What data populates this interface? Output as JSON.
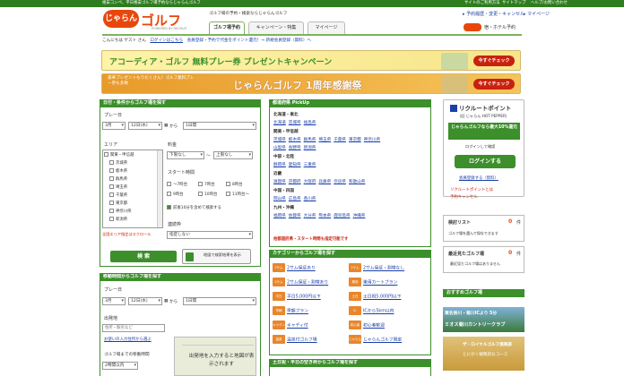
{
  "topbar": {
    "left_text": "格安コンペ、平日格安ゴルフ場予約ならじゃらんゴルフ",
    "right_links": [
      "サイトのご利用方法",
      "サイトマップ",
      "ヘルプ/お問い合わせ"
    ]
  },
  "header": {
    "brand_badge": "じゃらん",
    "brand_golf": "ゴルフ",
    "brand_sub": "POWERED BY RECRUIT",
    "tagline": "ゴルフ場の予約・検索ならじゃらんゴルフ",
    "top_links": [
      "予約履歴・変更・キャンセル",
      "マイページ"
    ],
    "tabs": [
      "ゴルフ場予約",
      "キャンペーン・特集",
      "マイページ"
    ],
    "hotel_link": "宿・ホテル予約",
    "welcome": "こんにちは ゲスト さん",
    "login": "ログインはこちら",
    "info": "会員登録・予約で代金をポイント還元！→ 新規会員登録（無料）へ"
  },
  "banners": [
    {
      "text": "アコーディア・ゴルフ 無料プレー券 プレゼントキャンペーン",
      "button": "今すぐチェック",
      "color": "#f6e58a"
    },
    {
      "text": "じゃらんゴルフ 1周年感謝祭",
      "sub": "豪華プレゼントもりだくさん！ゴルフ無料プレー券も多数",
      "button": "今すぐチェック",
      "color": "#f3b43a"
    }
  ],
  "left_panel": {
    "title": "日付・条件からゴルフ場を探す",
    "play_date_label": "プレー日",
    "month": "3月",
    "day": "12日(水)",
    "from": "から",
    "range": "1日間",
    "area_label": "エリア",
    "areas": [
      "関東・甲信越",
      "茨城県",
      "栃木県",
      "群馬県",
      "埼玉県",
      "千葉県",
      "東京都",
      "神奈川県",
      "新潟県"
    ],
    "area_note": "全国エリア指定はスクロール",
    "price_label": "料金",
    "price_min": "下限なし",
    "price_tilde": "〜",
    "price_max": "上限なし",
    "start_label": "スタート時間",
    "starts": [
      "〜7時台",
      "7時台",
      "8時台",
      "9時台",
      "10時台",
      "11時台〜"
    ],
    "start_note": "前後10分を含めて検索する",
    "route_label": "連続枠",
    "route_value": "指定しない",
    "search_button": "検 索",
    "map_button": "地図で検索結果を表示"
  },
  "left_panel2": {
    "title": "移動時間からゴルフ場を探す",
    "play_date_label": "プレー日",
    "month": "3月",
    "day": "12日(水)",
    "from": "から",
    "range": "1日間",
    "origin_label": "出発地",
    "origin_placeholder": "住所・駅名など",
    "origin_help": "お使いの入力住所から選ぶ",
    "time_label": "ゴルフ場までの移動時間",
    "time_value": "2時間以内",
    "map_hint": "出発地を入力すると地図が表示されます"
  },
  "pickup": {
    "title": "都道府県 PickUp",
    "regions": [
      {
        "name": "北海道・東北",
        "prefs": [
          "北海道",
          "宮城県",
          "福島県"
        ]
      },
      {
        "name": "関東・甲信越",
        "prefs": [
          "茨城県",
          "栃木県",
          "群馬県",
          "埼玉県",
          "千葉県",
          "東京都",
          "神奈川県",
          "山梨県",
          "長野県",
          "新潟県"
        ]
      },
      {
        "name": "中部・北陸",
        "prefs": [
          "静岡県",
          "愛知県",
          "三重県"
        ]
      },
      {
        "name": "近畿",
        "prefs": [
          "滋賀県",
          "京都府",
          "大阪府",
          "兵庫県",
          "奈良県",
          "和歌山県"
        ]
      },
      {
        "name": "中国・四国",
        "prefs": [
          "岡山県",
          "広島県",
          "香川県"
        ]
      },
      {
        "name": "九州・沖縄",
        "prefs": [
          "福岡県",
          "佐賀県",
          "大分県",
          "熊本県",
          "鹿児島県",
          "沖縄県"
        ]
      }
    ],
    "note": "他都道府県・スタート時間も指定可能です"
  },
  "categories": {
    "title": "カテゴリーからゴルフ場を探す",
    "items": [
      {
        "icon": "2サム",
        "label": "2サム保証あり"
      },
      {
        "icon": "2サム",
        "label": "2サム保証・割増なし"
      },
      {
        "icon": "2サム",
        "label": "2サム保証・割増あり"
      },
      {
        "icon": "乗用",
        "label": "乗用カートプラン"
      },
      {
        "icon": "平日",
        "label": "平日5,000円以下"
      },
      {
        "icon": "土日",
        "label": "土日祝5,000円以下"
      },
      {
        "icon": "早朝",
        "label": "早朝プラン"
      },
      {
        "icon": "IC",
        "label": "ICから5km以内"
      },
      {
        "icon": "キャディ",
        "label": "キャディ付"
      },
      {
        "icon": "初心者",
        "label": "初心者歓迎"
      },
      {
        "icon": "温泉",
        "label": "温泉付ゴルフ場"
      },
      {
        "icon": "じゃらん",
        "label": "じゃらんゴルフ限定"
      }
    ]
  },
  "weekday": {
    "title": "土日祝・平日の空き枠からゴルフ場を探す"
  },
  "right_panel": {
    "points_title": "リクルートポイント",
    "points_sub": "（旧 じゃらん HOT PEPPER）",
    "points_banner": "じゃらんゴルフなら最大10%還元",
    "login_note": "ログインして確認",
    "login_button": "ログインする",
    "register": "会員登録する（無料）",
    "points_link": "リクルートポイントとは",
    "coupon_link": "予約キャンセル",
    "check_label": "検討リスト",
    "check_count": "0",
    "check_unit": "件",
    "check_note": "ゴルフ場を選んで保存できます",
    "recent_label": "最近見たゴルフ場",
    "recent_count": "0",
    "recent_unit": "件",
    "recent_note": "最近見たゴルフ場はありません",
    "recommend_title": "おすすめゴルフ場",
    "ad1_title": "ミオス菊川カントリークラブ",
    "ad1_sub": "東名掛川・菊川ICより 5分",
    "ad2_title": "ザ・ロイヤルゴルフ倶楽部",
    "ad2_sub": "とにかく戦略的なコース"
  }
}
